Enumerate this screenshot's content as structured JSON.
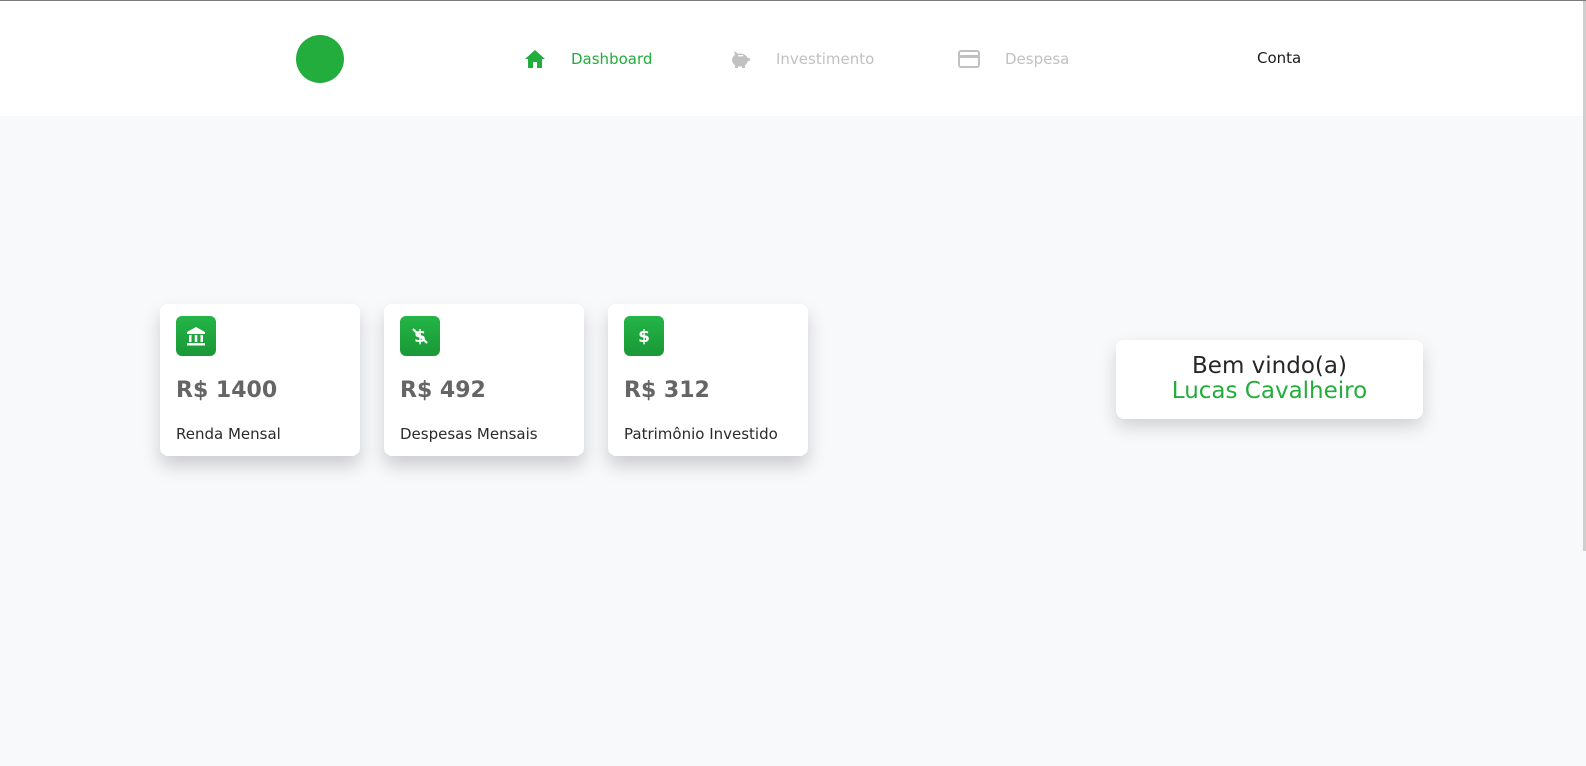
{
  "nav": {
    "items": [
      {
        "label": "Dashboard",
        "icon": "home-icon",
        "active": true
      },
      {
        "label": "Investimento",
        "icon": "piggy-bank-icon",
        "active": false
      },
      {
        "label": "Despesa",
        "icon": "credit-card-icon",
        "active": false
      }
    ],
    "account_label": "Conta"
  },
  "cards": [
    {
      "icon": "bank-icon",
      "value": "R$ 1400",
      "label": "Renda Mensal"
    },
    {
      "icon": "money-off-icon",
      "value": "R$ 492",
      "label": "Despesas Mensais"
    },
    {
      "icon": "dollar-icon",
      "value": "R$ 312",
      "label": "Patrimônio Investido"
    }
  ],
  "welcome": {
    "greeting": "Bem vindo(a)",
    "name": "Lucas Cavalheiro"
  },
  "colors": {
    "accent": "#22ad3c",
    "inactive_nav": "#c1c1c1",
    "background": "#f8f9fb"
  }
}
